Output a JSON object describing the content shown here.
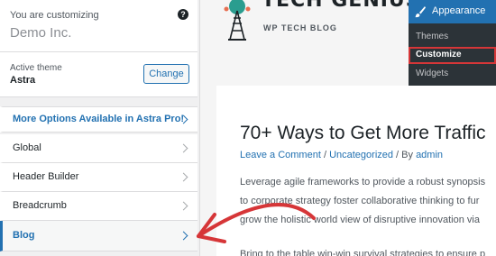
{
  "sidebar": {
    "customizing_label": "You are customizing",
    "site_name": "Demo Inc.",
    "active_theme_label": "Active theme",
    "active_theme_name": "Astra",
    "change_button": "Change",
    "promo_link": "More Options Available in Astra Pro!",
    "sections": [
      {
        "label": "Global"
      },
      {
        "label": "Header Builder"
      },
      {
        "label": "Breadcrumb"
      },
      {
        "label": "Blog"
      }
    ],
    "selected_section": "Blog"
  },
  "preview": {
    "logo_text": "TECH GENIUS",
    "logo_tagline": "WP TECH BLOG",
    "post": {
      "title": "70+ Ways to Get More Traffic",
      "meta_comment": "Leave a Comment",
      "meta_separator": " / ",
      "meta_category": "Uncategorized",
      "meta_by": " / By ",
      "meta_author": "admin",
      "body_lines": [
        "Leverage agile frameworks to provide a robust synopsis",
        "to corporate strategy foster collaborative thinking to fur",
        "grow the holistic world view of disruptive innovation via",
        "Bring to the table win-win survival strategies to ensure p"
      ]
    }
  },
  "admin_menu": {
    "appearance_label": "Appearance",
    "items": [
      "Themes",
      "Customize",
      "Widgets"
    ],
    "highlighted": "Customize"
  },
  "colors": {
    "accent": "#2271b1",
    "annotation": "#d63638",
    "admin_bg": "#2c3338"
  },
  "icons": {
    "help": "help-icon",
    "appearance": "paintbrush-icon",
    "logo": "tower-icon",
    "chevron": "chevron-right-icon",
    "annotation": "arrow-annotation-icon"
  }
}
